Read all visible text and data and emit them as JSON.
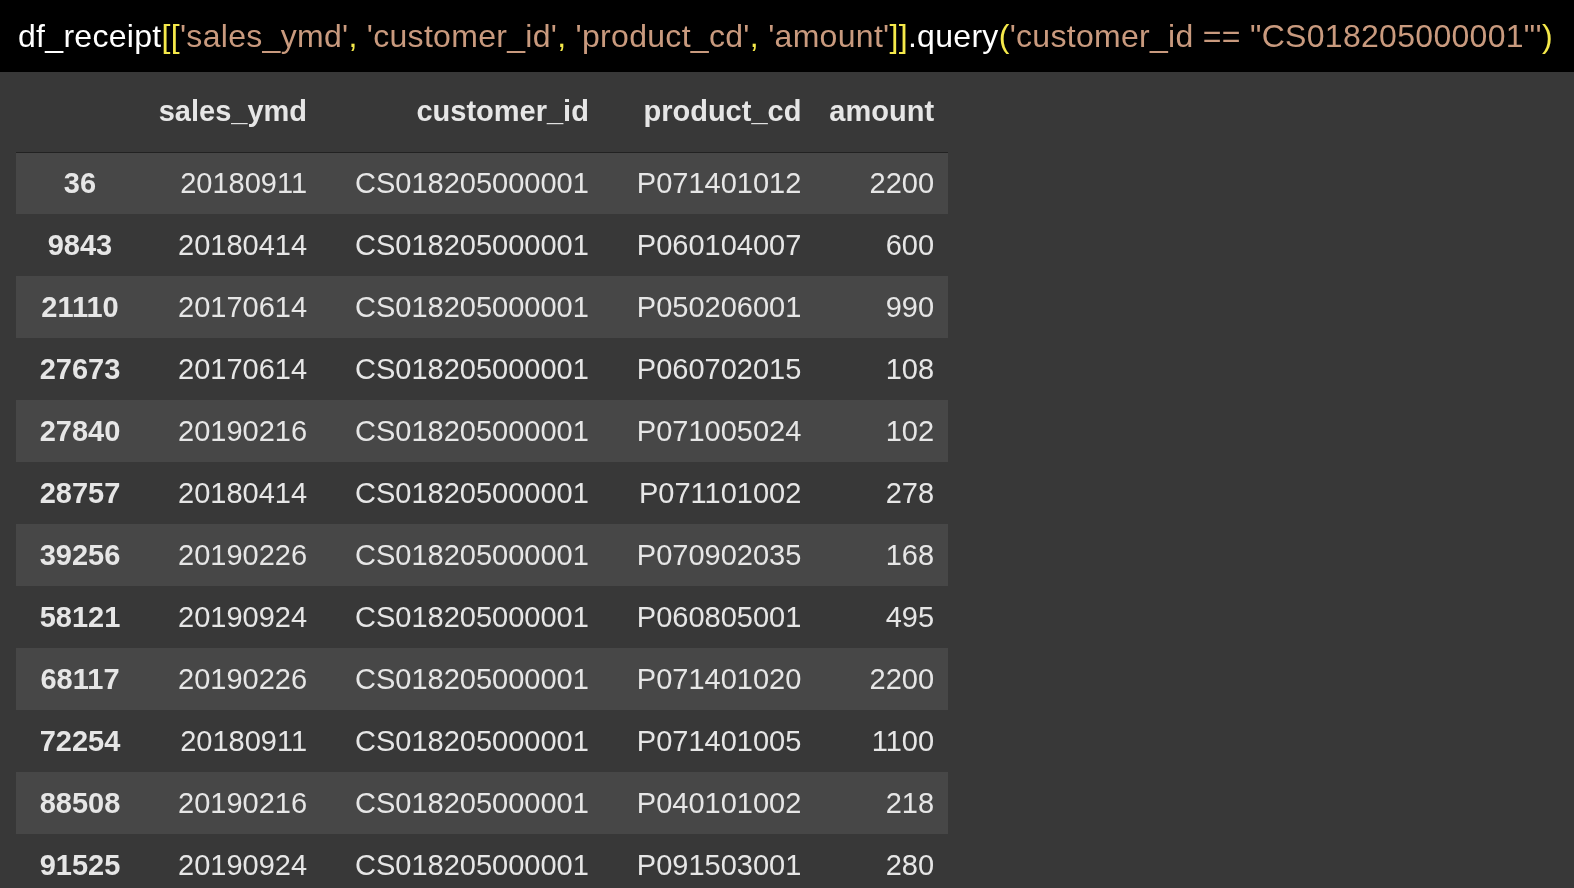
{
  "code_cell": {
    "tokens": [
      {
        "kind": "name",
        "text": "df_receipt"
      },
      {
        "kind": "bracket",
        "text": "[["
      },
      {
        "kind": "string",
        "text": "'sales_ymd'"
      },
      {
        "kind": "bracket",
        "text": ", "
      },
      {
        "kind": "string",
        "text": "'customer_id'"
      },
      {
        "kind": "bracket",
        "text": ", "
      },
      {
        "kind": "string",
        "text": "'product_cd'"
      },
      {
        "kind": "bracket",
        "text": ", "
      },
      {
        "kind": "string",
        "text": "'amount'"
      },
      {
        "kind": "bracket",
        "text": "]]"
      },
      {
        "kind": "name",
        "text": ".query"
      },
      {
        "kind": "bracket",
        "text": "("
      },
      {
        "kind": "string",
        "text": "'customer_id == \"CS018205000001\"'"
      },
      {
        "kind": "bracket",
        "text": ")"
      }
    ]
  },
  "table": {
    "columns": [
      "sales_ymd",
      "customer_id",
      "product_cd",
      "amount"
    ],
    "rows": [
      {
        "index": "36",
        "cells": [
          "20180911",
          "CS018205000001",
          "P071401012",
          "2200"
        ]
      },
      {
        "index": "9843",
        "cells": [
          "20180414",
          "CS018205000001",
          "P060104007",
          "600"
        ]
      },
      {
        "index": "21110",
        "cells": [
          "20170614",
          "CS018205000001",
          "P050206001",
          "990"
        ]
      },
      {
        "index": "27673",
        "cells": [
          "20170614",
          "CS018205000001",
          "P060702015",
          "108"
        ]
      },
      {
        "index": "27840",
        "cells": [
          "20190216",
          "CS018205000001",
          "P071005024",
          "102"
        ]
      },
      {
        "index": "28757",
        "cells": [
          "20180414",
          "CS018205000001",
          "P071101002",
          "278"
        ]
      },
      {
        "index": "39256",
        "cells": [
          "20190226",
          "CS018205000001",
          "P070902035",
          "168"
        ]
      },
      {
        "index": "58121",
        "cells": [
          "20190924",
          "CS018205000001",
          "P060805001",
          "495"
        ]
      },
      {
        "index": "68117",
        "cells": [
          "20190226",
          "CS018205000001",
          "P071401020",
          "2200"
        ]
      },
      {
        "index": "72254",
        "cells": [
          "20180911",
          "CS018205000001",
          "P071401005",
          "1100"
        ]
      },
      {
        "index": "88508",
        "cells": [
          "20190216",
          "CS018205000001",
          "P040101002",
          "218"
        ]
      },
      {
        "index": "91525",
        "cells": [
          "20190924",
          "CS018205000001",
          "P091503001",
          "280"
        ]
      }
    ]
  }
}
